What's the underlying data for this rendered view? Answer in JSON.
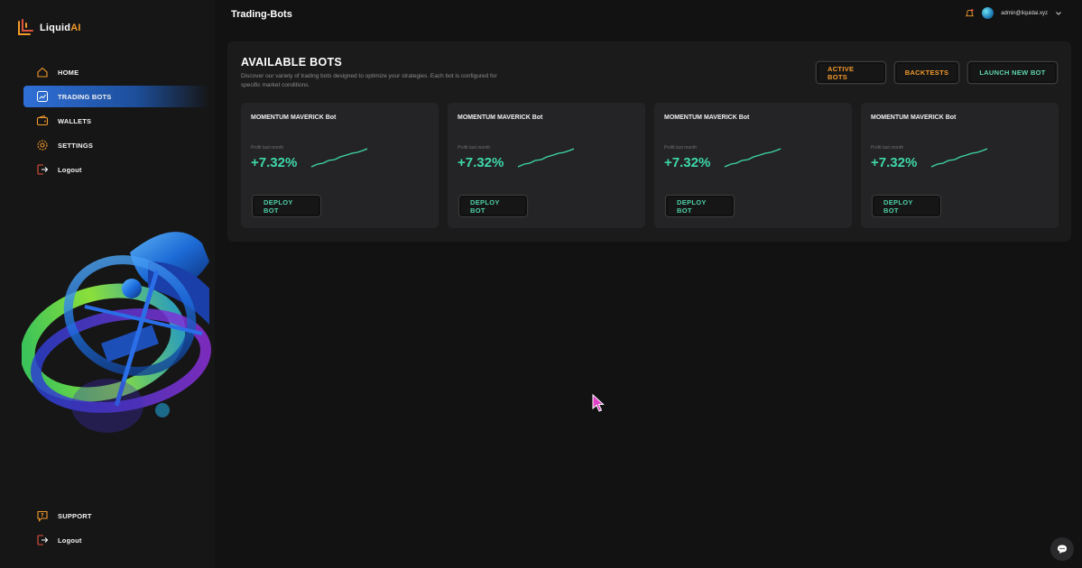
{
  "brand": {
    "name": "Liquid",
    "suffix": "AI",
    "accent": "#f39a2b"
  },
  "header": {
    "title": "Trading-Bots",
    "user_email": "admin@liquidai.xyz"
  },
  "sidebar": {
    "items": [
      {
        "label": "HOME",
        "icon": "home-icon"
      },
      {
        "label": "TRADING BOTS",
        "icon": "chart-line-icon",
        "active": true
      },
      {
        "label": "WALLETS",
        "icon": "wallet-icon"
      },
      {
        "label": "SETTINGS",
        "icon": "gear-icon"
      },
      {
        "label": "Logout",
        "icon": "logout-icon"
      }
    ],
    "bottom_items": [
      {
        "label": "SUPPORT",
        "icon": "help-icon"
      },
      {
        "label": "Logout",
        "icon": "logout-icon"
      }
    ]
  },
  "main": {
    "title": "AVAILABLE BOTS",
    "description": "Discover our variety of trading bots designed to optimize your strategies. Each bot is configured for specific market conditions.",
    "actions": {
      "active_bots": "ACTIVE BOTS",
      "backtests": "BACKTESTS",
      "launch_new_bot": "LAUNCH NEW BOT"
    },
    "cards": [
      {
        "title": "MOMENTUM MAVERICK Bot",
        "profit_label": "Profit last month",
        "profit_value": "+7.32%",
        "deploy_label": "DEPLOY BOT"
      },
      {
        "title": "MOMENTUM MAVERICK Bot",
        "profit_label": "Profit last month",
        "profit_value": "+7.32%",
        "deploy_label": "DEPLOY BOT"
      },
      {
        "title": "MOMENTUM MAVERICK Bot",
        "profit_label": "Profit last month",
        "profit_value": "+7.32%",
        "deploy_label": "DEPLOY BOT"
      },
      {
        "title": "MOMENTUM MAVERICK Bot",
        "profit_label": "Profit last month",
        "profit_value": "+7.32%",
        "deploy_label": "DEPLOY BOT"
      }
    ]
  },
  "colors": {
    "background": "#121212",
    "panel": "#1b1b1c",
    "card": "#242426",
    "profit_green": "#3ed8a8",
    "orange": "#f39a2b",
    "active_nav": "#2f6fd6"
  }
}
